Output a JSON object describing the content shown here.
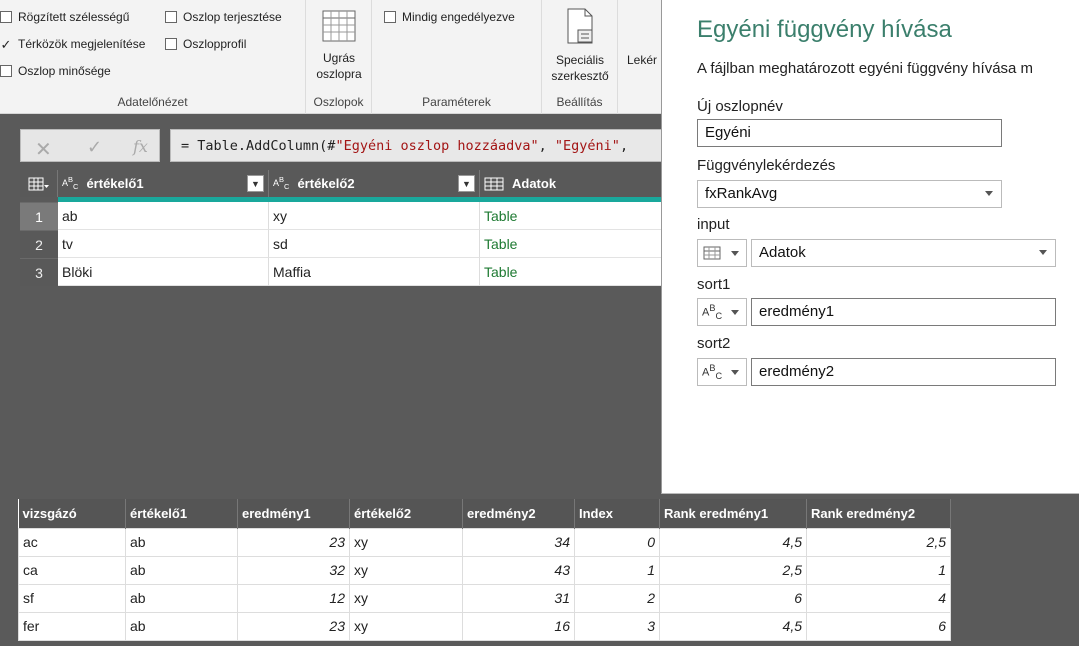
{
  "ribbon": {
    "view_group": {
      "label": "Adatelőnézet",
      "checkboxes": [
        {
          "label": "Rögzített szélességű",
          "checked": false
        },
        {
          "label": "Térközök megjelenítése",
          "checked": true
        },
        {
          "label": "Oszlop minősége",
          "checked": false
        },
        {
          "label": "Oszlop terjesztése",
          "checked": false
        },
        {
          "label": "Oszlopprofil",
          "checked": false
        }
      ]
    },
    "columns_group": {
      "label": "Oszlopok",
      "goto_label_1": "Ugrás",
      "goto_label_2": "oszlopra"
    },
    "params_group": {
      "label": "Paraméterek",
      "always_allow": "Mindig engedélyezve"
    },
    "settings_group": {
      "label": "Beállítás",
      "editor_label_1": "Speciális",
      "editor_label_2": "szerkesztő"
    },
    "query_cut": "Lekér"
  },
  "formula": {
    "prefix": "= Table.AddColumn(#",
    "str1": "\"Egyéni oszlop hozzáadva\"",
    "mid": ", ",
    "str2": "\"Egyéni\"",
    "suffix": ","
  },
  "query_table": {
    "columns": [
      {
        "name": "értékelő1",
        "type": "ABC"
      },
      {
        "name": "értékelő2",
        "type": "ABC"
      },
      {
        "name": "Adatok",
        "type": "table"
      }
    ],
    "rows": [
      {
        "num": "1",
        "c1": "ab",
        "c2": "xy",
        "c3": "Table"
      },
      {
        "num": "2",
        "c1": "tv",
        "c2": "sd",
        "c3": "Table"
      },
      {
        "num": "3",
        "c1": "Blöki",
        "c2": "Maffia",
        "c3": "Table"
      }
    ]
  },
  "dialog": {
    "title": "Egyéni függvény hívása",
    "subtitle": "A fájlban meghatározott egyéni függvény hívása m",
    "colname_label": "Új oszlopnév",
    "colname_value": "Egyéni",
    "func_label": "Függvénylekérdezés",
    "func_value": "fxRankAvg",
    "input_label": "input",
    "input_value": "Adatok",
    "sort1_label": "sort1",
    "sort1_value": "eredmény1",
    "sort2_label": "sort2",
    "sort2_value": "eredmény2"
  },
  "bottom_table": {
    "headers": [
      "vizsgázó",
      "értékelő1",
      "eredmény1",
      "értékelő2",
      "eredmény2",
      "Index",
      "Rank eredmény1",
      "Rank eredmény2"
    ],
    "rows": [
      [
        "ac",
        "ab",
        "23",
        "xy",
        "34",
        "0",
        "4,5",
        "2,5"
      ],
      [
        "ca",
        "ab",
        "32",
        "xy",
        "43",
        "1",
        "2,5",
        "1"
      ],
      [
        "sf",
        "ab",
        "12",
        "xy",
        "31",
        "2",
        "6",
        "4"
      ],
      [
        "fer",
        "ab",
        "23",
        "xy",
        "16",
        "3",
        "4,5",
        "6"
      ]
    ]
  }
}
